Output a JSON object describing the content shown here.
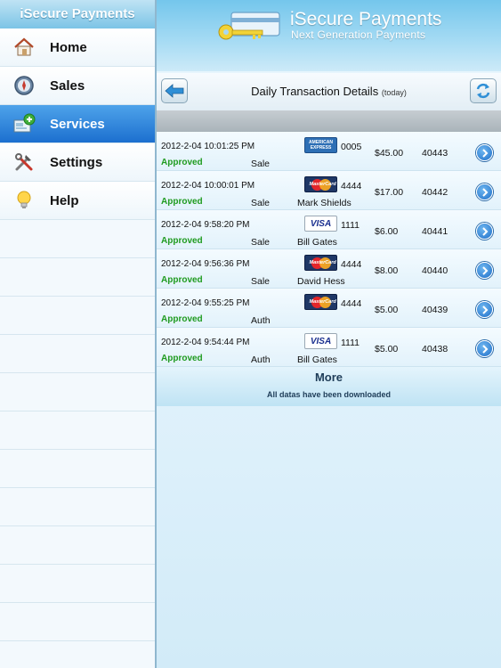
{
  "sidebar": {
    "title": "iSecure Payments",
    "items": [
      {
        "label": "Home",
        "icon": "house-icon"
      },
      {
        "label": "Sales",
        "icon": "compass-icon"
      },
      {
        "label": "Services",
        "icon": "services-icon",
        "active": true
      },
      {
        "label": "Settings",
        "icon": "tools-icon"
      },
      {
        "label": "Help",
        "icon": "lightbulb-icon"
      }
    ]
  },
  "banner": {
    "title": "iSecure Payments",
    "subtitle": "Next Generation Payments",
    "logo_icon": "card-key-icon"
  },
  "toolbar": {
    "title": "Daily Transaction Details",
    "title_sub": "(today)",
    "back_icon": "back-arrow-icon",
    "refresh_icon": "refresh-icon"
  },
  "transactions": [
    {
      "datetime": "2012-2-04 10:01:25 PM",
      "status": "Approved",
      "type": "Sale",
      "card": "amex",
      "last4": "0005",
      "name": "",
      "amount": "$45.00",
      "id": "40443"
    },
    {
      "datetime": "2012-2-04 10:00:01 PM",
      "status": "Approved",
      "type": "Sale",
      "card": "mastercard",
      "last4": "4444",
      "name": "Mark Shields",
      "amount": "$17.00",
      "id": "40442"
    },
    {
      "datetime": "2012-2-04 9:58:20 PM",
      "status": "Approved",
      "type": "Sale",
      "card": "visa",
      "last4": "1111",
      "name": "Bill Gates",
      "amount": "$6.00",
      "id": "40441"
    },
    {
      "datetime": "2012-2-04 9:56:36 PM",
      "status": "Approved",
      "type": "Sale",
      "card": "mastercard",
      "last4": "4444",
      "name": "David Hess",
      "amount": "$8.00",
      "id": "40440"
    },
    {
      "datetime": "2012-2-04 9:55:25 PM",
      "status": "Approved",
      "type": "Auth",
      "card": "mastercard",
      "last4": "4444",
      "name": "",
      "amount": "$5.00",
      "id": "40439"
    },
    {
      "datetime": "2012-2-04 9:54:44 PM",
      "status": "Approved",
      "type": "Auth",
      "card": "visa",
      "last4": "1111",
      "name": "Bill Gates",
      "amount": "$5.00",
      "id": "40438"
    }
  ],
  "card_labels": {
    "amex_line1": "AMERICAN",
    "amex_line2": "EXPRESS",
    "mastercard": "MasterCard",
    "visa": "VISA"
  },
  "more": {
    "label": "More",
    "note": "All datas have been downloaded"
  },
  "colors": {
    "approved": "#1f9b1f",
    "active_nav": "#1c6fcf",
    "banner": "#74c6ec"
  }
}
